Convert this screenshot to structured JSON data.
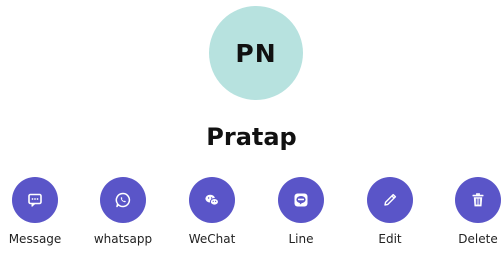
{
  "profile": {
    "initials": "PN",
    "name": "Pratap",
    "avatar_color": "#b7e2df"
  },
  "accent_color": "#5a55c8",
  "actions": [
    {
      "label": "Message",
      "icon": "message-icon"
    },
    {
      "label": "whatsapp",
      "icon": "whatsapp-icon"
    },
    {
      "label": "WeChat",
      "icon": "wechat-icon"
    },
    {
      "label": "Line",
      "icon": "line-icon"
    },
    {
      "label": "Edit",
      "icon": "pencil-icon"
    },
    {
      "label": "Delete",
      "icon": "trash-icon"
    }
  ]
}
